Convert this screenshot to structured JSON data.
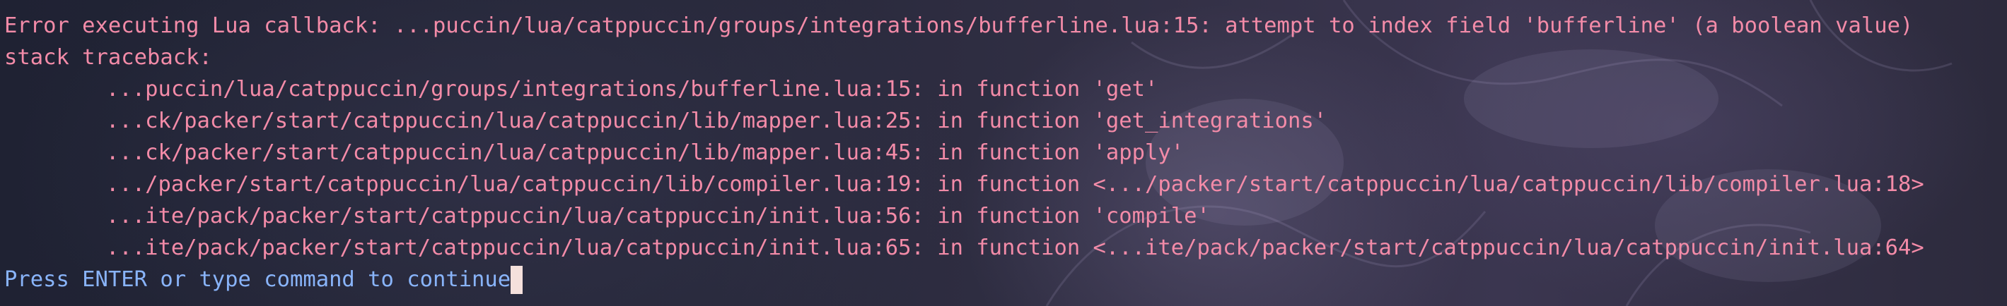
{
  "error": {
    "header": "Error executing Lua callback: ...puccin/lua/catppuccin/groups/integrations/bufferline.lua:15: attempt to index field 'bufferline' (a boolean value)",
    "traceback_label": "stack traceback:",
    "frames": [
      "...puccin/lua/catppuccin/groups/integrations/bufferline.lua:15: in function 'get'",
      "...ck/packer/start/catppuccin/lua/catppuccin/lib/mapper.lua:25: in function 'get_integrations'",
      "...ck/packer/start/catppuccin/lua/catppuccin/lib/mapper.lua:45: in function 'apply'",
      ".../packer/start/catppuccin/lua/catppuccin/lib/compiler.lua:19: in function <.../packer/start/catppuccin/lua/catppuccin/lib/compiler.lua:18>",
      "...ite/pack/packer/start/catppuccin/lua/catppuccin/init.lua:56: in function 'compile'",
      "...ite/pack/packer/start/catppuccin/lua/catppuccin/init.lua:65: in function <...ite/pack/packer/start/catppuccin/lua/catppuccin/init.lua:64>"
    ]
  },
  "prompt": {
    "text": "Press ENTER or type command to continue"
  },
  "colors": {
    "error_text": "#f38ba8",
    "prompt_text": "#89b4fa",
    "cursor": "#f5e0dc",
    "background": "#2f2c3d"
  }
}
